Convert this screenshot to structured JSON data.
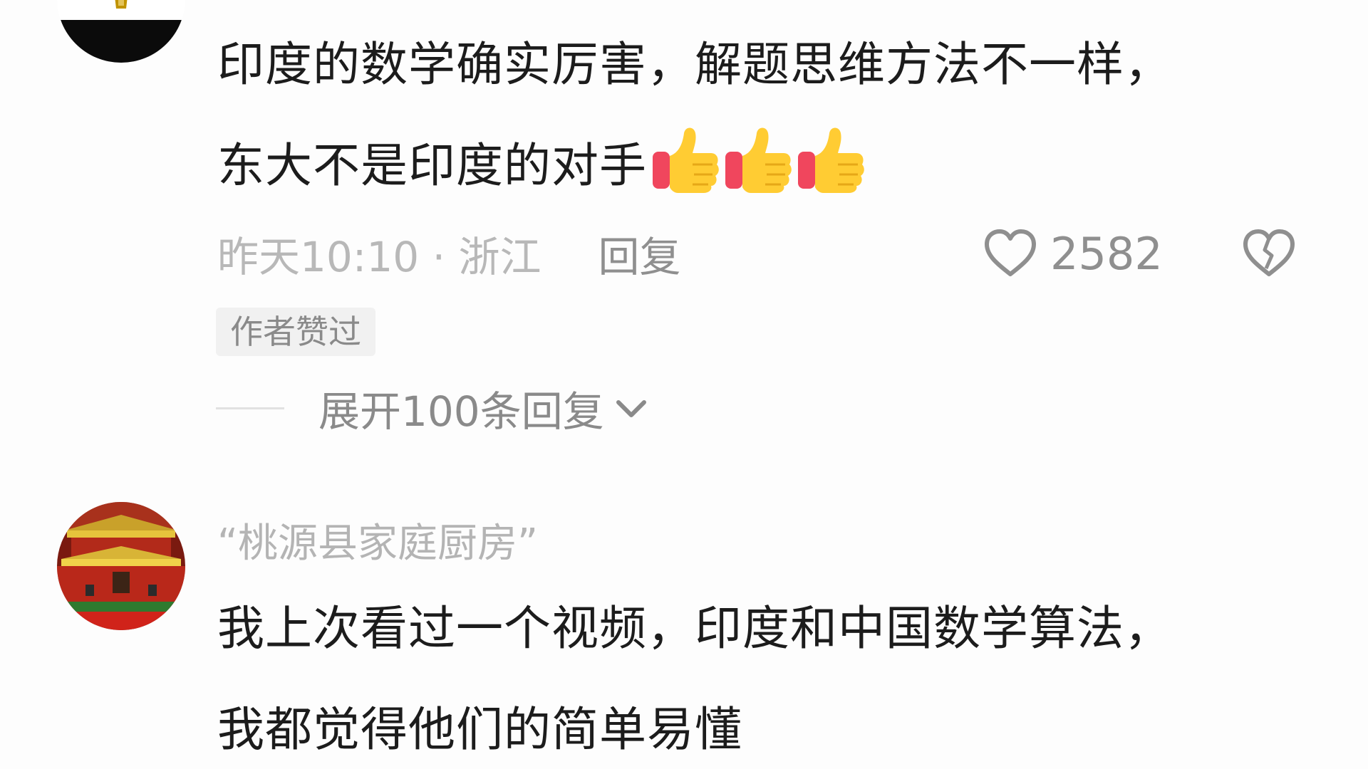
{
  "comments": [
    {
      "avatar": {
        "description_icon": "egypt-flag-avatar",
        "colors": [
          "#ce1126",
          "#ffffff",
          "#000000",
          "#c09300"
        ]
      },
      "text_line1": "印度的数学确实厉害，解题思维方法不一样，",
      "text_line2": "东大不是印度的对手",
      "emoji": [
        "thumbs-up-emoji",
        "thumbs-up-emoji",
        "thumbs-up-emoji"
      ],
      "time_location": "昨天10:10 · 浙江",
      "reply_label": "回复",
      "like_count": "2582",
      "author_badge": "作者赞过",
      "expand_label": "展开100条回复"
    },
    {
      "avatar": {
        "description_icon": "tiananmen-avatar"
      },
      "username": "“桃源县家庭厨房”",
      "text_line1": "我上次看过一个视频，印度和中国数学算法，",
      "text_line2": "我都觉得他们的简单易懂"
    }
  ],
  "colors": {
    "primary_text": "#1c1c1c",
    "meta_text": "#b8b8b8",
    "secondary_text": "#8f8f8f",
    "badge_bg": "#f1f1f1"
  }
}
